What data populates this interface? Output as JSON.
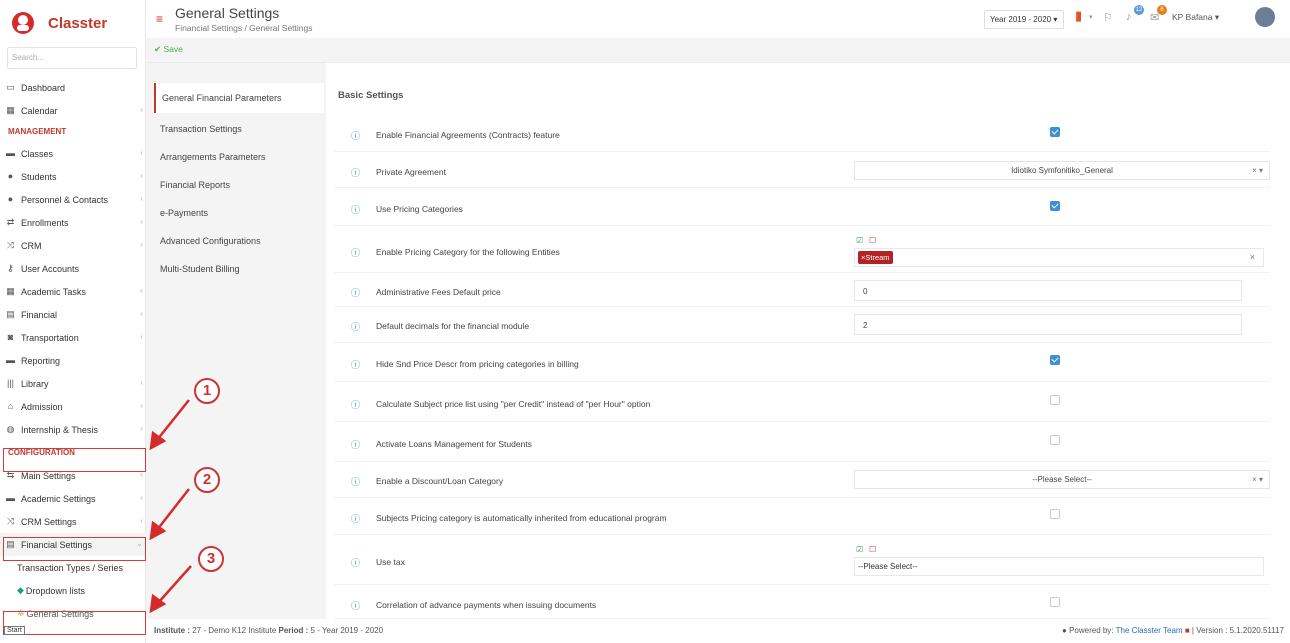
{
  "app": {
    "name": "Classter",
    "search_placeholder": "Search..."
  },
  "header": {
    "title": "General Settings",
    "breadcrumb": "Financial Settings  /  General Settings",
    "year": "Year 2019 - 2020 ▾",
    "notifications_count": "12",
    "messages_count": "6",
    "user": "KP Bafana ▾"
  },
  "toolbar": {
    "save_label": "✔ Save"
  },
  "sidebar": {
    "items": [
      {
        "label": "Dashboard",
        "icon": "💻"
      },
      {
        "label": "Calendar",
        "icon": "▦"
      }
    ],
    "management_label": "MANAGEMENT",
    "management": [
      {
        "label": "Classes",
        "icon": "▬"
      },
      {
        "label": "Students",
        "icon": "👥"
      },
      {
        "label": "Personnel & Contacts",
        "icon": "👤"
      },
      {
        "label": "Enrollments",
        "icon": "⇄"
      },
      {
        "label": "CRM",
        "icon": "⤨"
      },
      {
        "label": "User Accounts",
        "icon": "🔑"
      },
      {
        "label": "Academic Tasks",
        "icon": "▦"
      },
      {
        "label": "Financial",
        "icon": "▤"
      },
      {
        "label": "Transportation",
        "icon": "🚌"
      },
      {
        "label": "Reporting",
        "icon": "▬"
      },
      {
        "label": "Library",
        "icon": "|||"
      },
      {
        "label": "Admission",
        "icon": "🏛"
      },
      {
        "label": "Internship & Thesis",
        "icon": "◍"
      }
    ],
    "configuration_label": "CONFIGURATION",
    "configuration": [
      {
        "label": "Main Settings",
        "icon": "⇆"
      },
      {
        "label": "Academic Settings",
        "icon": "▬"
      },
      {
        "label": "CRM Settings",
        "icon": "⤨"
      },
      {
        "label": "Financial Settings",
        "icon": "▤"
      }
    ],
    "sub": [
      {
        "label": "Transaction Types / Series"
      },
      {
        "label": "Dropdown lists"
      },
      {
        "label": "General Settings"
      }
    ]
  },
  "submenu": [
    "General Financial Parameters",
    "Transaction Settings",
    "Arrangements Parameters",
    "Financial Reports",
    "e-Payments",
    "Advanced Configurations",
    "Multi-Student Billing"
  ],
  "content": {
    "section_title": "Basic Settings",
    "rows": [
      {
        "label": "Enable Financial Agreements (Contracts) feature",
        "control": "checkbox",
        "checked": true
      },
      {
        "label": "Private Agreement",
        "control": "select",
        "value": "Idiotiko Symfonitiko_General"
      },
      {
        "label": "Use Pricing Categories",
        "control": "checkbox",
        "checked": true
      },
      {
        "label": "Enable Pricing Category for the following Entities",
        "control": "tags",
        "tag": "×Stream"
      },
      {
        "label": "Administrative Fees Default price",
        "control": "input",
        "value": "0"
      },
      {
        "label": "Default decimals for the financial module",
        "control": "input",
        "value": "2"
      },
      {
        "label": "Hide Snd Price Descr from pricing categories in billing",
        "control": "checkbox",
        "checked": true
      },
      {
        "label": "Calculate Subject price list using \"per Credit\" instead of \"per Hour\" option",
        "control": "checkbox",
        "checked": false
      },
      {
        "label": "Activate Loans Management for Students",
        "control": "checkbox",
        "checked": false
      },
      {
        "label": "Enable a Discount/Loan Category",
        "control": "select",
        "value": "--Please Select--"
      },
      {
        "label": "Subjects Pricing category is automatically inherited from educational program",
        "control": "checkbox",
        "checked": false
      },
      {
        "label": "Use tax",
        "control": "select-plain",
        "value": "--Please Select--"
      },
      {
        "label": "Correlation of advance payments when issuing documents",
        "control": "checkbox",
        "checked": false
      }
    ]
  },
  "footer": {
    "institute_label": "Institute :",
    "institute_value": "27 - Demo K12 Institute",
    "period_label": "Period :",
    "period_value": "5 - Year 2019 - 2020",
    "powered_label": "Powered by:",
    "powered_team": "The Classter Team",
    "version": "| Version : 5.1.2020.51117"
  },
  "markers": [
    "1",
    "2",
    "3"
  ],
  "taskbar": {
    "start": "Start"
  },
  "colors": {
    "accent": "#c0392b",
    "check": "#3d8fd6",
    "save": "#4cae4c"
  }
}
